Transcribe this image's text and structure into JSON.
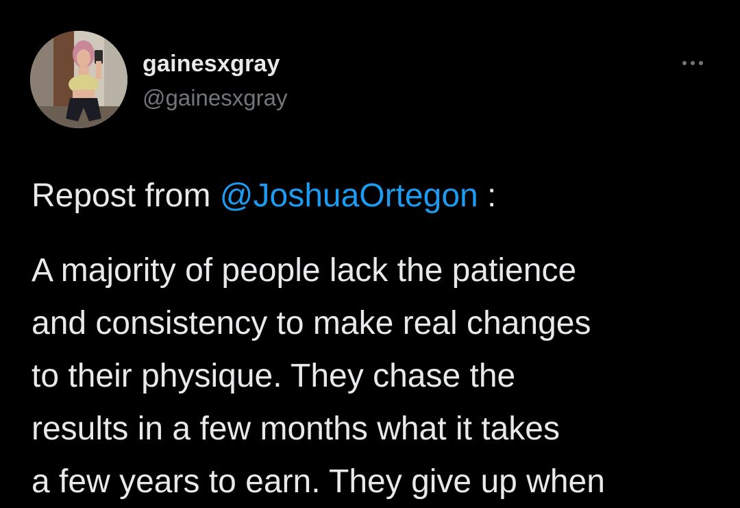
{
  "author": {
    "name": "gainesxgray",
    "handle": "@gainesxgray"
  },
  "repost": {
    "prefix": "Repost from ",
    "mention": "@JoshuaOrtegon",
    "suffix": " :"
  },
  "body_lines": [
    "A majority of people lack the patience",
    "and consistency to make real changes",
    "to their physique. They chase the",
    "results in a few months what it takes",
    "a few years to earn. They give up when"
  ],
  "icons": {
    "more": "more-horizontal-icon"
  },
  "colors": {
    "background": "#000000",
    "text": "#e7e9ea",
    "muted": "#71767b",
    "link": "#1d9bf0"
  }
}
